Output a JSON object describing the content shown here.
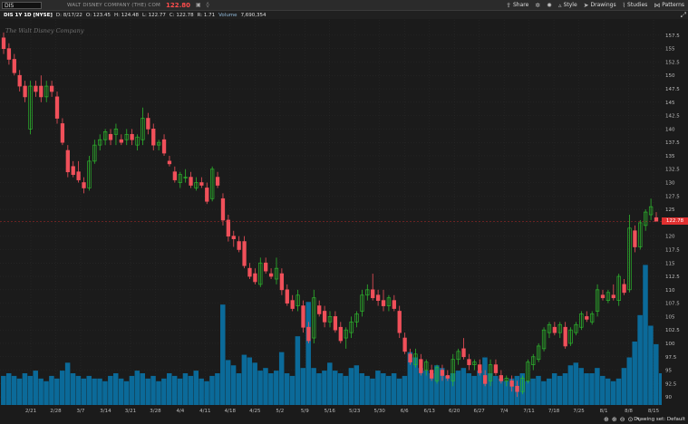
{
  "header": {
    "symbol": "DIS",
    "company": "WALT DISNEY COMPANY (THE) COM",
    "last_price": "122.80",
    "toolbar": {
      "share": "Share",
      "style": "Style",
      "drawings": "Drawings",
      "studies": "Studies",
      "patterns": "Patterns"
    }
  },
  "infobar": {
    "descriptor": "DIS 1Y 1D [NYSE]",
    "date": "D: 8/17/22",
    "open": "O: 123.45",
    "high": "H: 124.48",
    "low": "L: 122.77",
    "close": "C: 122.78",
    "range": "R: 1.71",
    "volume_label": "Volume",
    "volume": "7,690,354"
  },
  "watermark": "The Walt Disney Company",
  "price_tag": "122.78",
  "footer": {
    "drawing_set": "Drawing set: Default"
  },
  "chart_data": {
    "type": "candlestick",
    "y_ticks": [
      "157.5",
      "155",
      "152.5",
      "150",
      "147.5",
      "145",
      "142.5",
      "140",
      "137.5",
      "135",
      "132.5",
      "130",
      "127.5",
      "125",
      "122.5",
      "120",
      "117.5",
      "115",
      "112.5",
      "110",
      "107.5",
      "105",
      "102.5",
      "100",
      "97.5",
      "95",
      "92.5",
      "90"
    ],
    "ylim": [
      88.5,
      159
    ],
    "x_ticks": [
      "2/21",
      "2/28",
      "3/7",
      "3/14",
      "3/21",
      "3/28",
      "4/4",
      "4/11",
      "4/18",
      "4/25",
      "5/2",
      "5/9",
      "5/16",
      "5/23",
      "5/30",
      "6/6",
      "6/13",
      "6/20",
      "6/27",
      "7/4",
      "7/11",
      "7/18",
      "7/25",
      "8/1",
      "8/8",
      "8/15"
    ],
    "colors": {
      "up": "#2db52d",
      "down": "#f0505a",
      "volume": "#0b6a99",
      "background": "#1b1b1b",
      "grid": "#2c2c2c"
    },
    "candles": [
      {
        "o": 157,
        "h": 158,
        "l": 154,
        "c": 155
      },
      {
        "o": 155,
        "h": 156,
        "l": 152,
        "c": 153
      },
      {
        "o": 153,
        "h": 154,
        "l": 150,
        "c": 150.5
      },
      {
        "o": 150,
        "h": 151,
        "l": 147,
        "c": 148
      },
      {
        "o": 148,
        "h": 149,
        "l": 145,
        "c": 146
      },
      {
        "o": 140,
        "h": 149,
        "l": 139,
        "c": 148
      },
      {
        "o": 148,
        "h": 149,
        "l": 146,
        "c": 147
      },
      {
        "o": 148,
        "h": 150,
        "l": 145,
        "c": 146
      },
      {
        "o": 146,
        "h": 149,
        "l": 145,
        "c": 148
      },
      {
        "o": 148,
        "h": 149,
        "l": 146,
        "c": 147
      },
      {
        "o": 146,
        "h": 147,
        "l": 141,
        "c": 142
      },
      {
        "o": 141,
        "h": 142,
        "l": 137,
        "c": 137.5
      },
      {
        "o": 136,
        "h": 137,
        "l": 131,
        "c": 132
      },
      {
        "o": 133,
        "h": 134,
        "l": 131,
        "c": 131.5
      },
      {
        "o": 132,
        "h": 134,
        "l": 130,
        "c": 130.5
      },
      {
        "o": 130,
        "h": 131,
        "l": 128,
        "c": 129
      },
      {
        "o": 129,
        "h": 135,
        "l": 128.5,
        "c": 134
      },
      {
        "o": 134,
        "h": 138,
        "l": 133.5,
        "c": 137
      },
      {
        "o": 137,
        "h": 139,
        "l": 136,
        "c": 138
      },
      {
        "o": 138,
        "h": 140,
        "l": 137,
        "c": 139.5
      },
      {
        "o": 139,
        "h": 140,
        "l": 137,
        "c": 138
      },
      {
        "o": 139,
        "h": 141,
        "l": 137,
        "c": 140
      },
      {
        "o": 138,
        "h": 139,
        "l": 137,
        "c": 137.5
      },
      {
        "o": 138,
        "h": 140,
        "l": 137,
        "c": 139
      },
      {
        "o": 139,
        "h": 140,
        "l": 137,
        "c": 138
      },
      {
        "o": 137,
        "h": 139,
        "l": 136,
        "c": 138.5
      },
      {
        "o": 138,
        "h": 144,
        "l": 137,
        "c": 142
      },
      {
        "o": 142,
        "h": 143,
        "l": 139,
        "c": 140
      },
      {
        "o": 140,
        "h": 141,
        "l": 136,
        "c": 137
      },
      {
        "o": 137,
        "h": 138,
        "l": 136,
        "c": 137.5
      },
      {
        "o": 138,
        "h": 139,
        "l": 135,
        "c": 135.5
      },
      {
        "o": 134,
        "h": 135,
        "l": 133,
        "c": 133.5
      },
      {
        "o": 132,
        "h": 133,
        "l": 130,
        "c": 130.5
      },
      {
        "o": 130,
        "h": 132,
        "l": 129,
        "c": 131.5
      },
      {
        "o": 131,
        "h": 132.5,
        "l": 130,
        "c": 131
      },
      {
        "o": 131,
        "h": 132,
        "l": 129,
        "c": 129.5
      },
      {
        "o": 129,
        "h": 131,
        "l": 128.5,
        "c": 130
      },
      {
        "o": 130,
        "h": 131,
        "l": 129,
        "c": 129.5
      },
      {
        "o": 129,
        "h": 130,
        "l": 126,
        "c": 126.5
      },
      {
        "o": 127,
        "h": 133,
        "l": 126.5,
        "c": 132.5
      },
      {
        "o": 131,
        "h": 132,
        "l": 129,
        "c": 129.5
      },
      {
        "o": 127,
        "h": 128,
        "l": 122,
        "c": 123
      },
      {
        "o": 123,
        "h": 124,
        "l": 119,
        "c": 120
      },
      {
        "o": 120,
        "h": 121,
        "l": 118,
        "c": 119.5
      },
      {
        "o": 119,
        "h": 120,
        "l": 117,
        "c": 117.5
      },
      {
        "o": 119,
        "h": 120,
        "l": 114,
        "c": 114.5
      },
      {
        "o": 114,
        "h": 115,
        "l": 112,
        "c": 112.5
      },
      {
        "o": 113,
        "h": 114,
        "l": 111,
        "c": 111.5
      },
      {
        "o": 111,
        "h": 116,
        "l": 110.5,
        "c": 115
      },
      {
        "o": 115,
        "h": 116,
        "l": 113,
        "c": 113.5
      },
      {
        "o": 113,
        "h": 114,
        "l": 112,
        "c": 112.5
      },
      {
        "o": 112,
        "h": 116,
        "l": 111,
        "c": 114
      },
      {
        "o": 113,
        "h": 114,
        "l": 109,
        "c": 110
      },
      {
        "o": 110,
        "h": 111,
        "l": 107,
        "c": 107.5
      },
      {
        "o": 108,
        "h": 109,
        "l": 106,
        "c": 106.5
      },
      {
        "o": 107,
        "h": 110,
        "l": 106,
        "c": 109
      },
      {
        "o": 107,
        "h": 108,
        "l": 102,
        "c": 103
      },
      {
        "o": 103,
        "h": 104,
        "l": 100,
        "c": 100.5
      },
      {
        "o": 101,
        "h": 110,
        "l": 100,
        "c": 108.5
      },
      {
        "o": 107,
        "h": 108,
        "l": 105,
        "c": 105.5
      },
      {
        "o": 106,
        "h": 107,
        "l": 103,
        "c": 104
      },
      {
        "o": 104,
        "h": 106,
        "l": 103,
        "c": 105
      },
      {
        "o": 105,
        "h": 106,
        "l": 102,
        "c": 102.5
      },
      {
        "o": 103,
        "h": 104,
        "l": 100,
        "c": 100.5
      },
      {
        "o": 101,
        "h": 103,
        "l": 99,
        "c": 102.5
      },
      {
        "o": 102,
        "h": 105,
        "l": 101,
        "c": 104
      },
      {
        "o": 104,
        "h": 106,
        "l": 103,
        "c": 105.5
      },
      {
        "o": 106,
        "h": 110,
        "l": 105,
        "c": 109
      },
      {
        "o": 109,
        "h": 111,
        "l": 108,
        "c": 110
      },
      {
        "o": 110,
        "h": 113,
        "l": 108,
        "c": 108.5
      },
      {
        "o": 109,
        "h": 110,
        "l": 107,
        "c": 108
      },
      {
        "o": 108,
        "h": 110,
        "l": 106,
        "c": 107
      },
      {
        "o": 107,
        "h": 109,
        "l": 106,
        "c": 108.5
      },
      {
        "o": 108,
        "h": 109,
        "l": 106,
        "c": 106.5
      },
      {
        "o": 106,
        "h": 107,
        "l": 101,
        "c": 102
      },
      {
        "o": 101,
        "h": 102,
        "l": 98,
        "c": 98.5
      },
      {
        "o": 98,
        "h": 99,
        "l": 96,
        "c": 96.5
      },
      {
        "o": 96,
        "h": 99,
        "l": 95.5,
        "c": 98
      },
      {
        "o": 97,
        "h": 98,
        "l": 94,
        "c": 94.5
      },
      {
        "o": 95,
        "h": 97,
        "l": 94,
        "c": 96.5
      },
      {
        "o": 95,
        "h": 96,
        "l": 93,
        "c": 93.5
      },
      {
        "o": 93,
        "h": 96,
        "l": 92.5,
        "c": 95.5
      },
      {
        "o": 95,
        "h": 96,
        "l": 93,
        "c": 94
      },
      {
        "o": 94,
        "h": 95,
        "l": 93,
        "c": 93.5
      },
      {
        "o": 93,
        "h": 98,
        "l": 92,
        "c": 97
      },
      {
        "o": 97,
        "h": 99,
        "l": 96,
        "c": 98.5
      },
      {
        "o": 99,
        "h": 101,
        "l": 97,
        "c": 97.5
      },
      {
        "o": 97,
        "h": 98,
        "l": 95,
        "c": 96
      },
      {
        "o": 96,
        "h": 97,
        "l": 95,
        "c": 96.5
      },
      {
        "o": 96,
        "h": 97,
        "l": 94,
        "c": 94.5
      },
      {
        "o": 94,
        "h": 95,
        "l": 92,
        "c": 92.5
      },
      {
        "o": 93,
        "h": 97,
        "l": 92,
        "c": 96
      },
      {
        "o": 96,
        "h": 97,
        "l": 94,
        "c": 94.5
      },
      {
        "o": 94,
        "h": 95,
        "l": 92.5,
        "c": 93
      },
      {
        "o": 93,
        "h": 94,
        "l": 92,
        "c": 93.5
      },
      {
        "o": 93,
        "h": 94,
        "l": 91,
        "c": 92
      },
      {
        "o": 92,
        "h": 93,
        "l": 90,
        "c": 91
      },
      {
        "o": 91,
        "h": 94,
        "l": 90.5,
        "c": 93.5
      },
      {
        "o": 93,
        "h": 97,
        "l": 92.5,
        "c": 96.5
      },
      {
        "o": 96,
        "h": 98,
        "l": 95,
        "c": 97.5
      },
      {
        "o": 97,
        "h": 100,
        "l": 96.5,
        "c": 99.5
      },
      {
        "o": 99,
        "h": 103,
        "l": 98.5,
        "c": 102.5
      },
      {
        "o": 102,
        "h": 104,
        "l": 101,
        "c": 103.5
      },
      {
        "o": 103,
        "h": 104,
        "l": 101.5,
        "c": 102
      },
      {
        "o": 102,
        "h": 104,
        "l": 101,
        "c": 103.5
      },
      {
        "o": 103,
        "h": 104,
        "l": 99,
        "c": 99.5
      },
      {
        "o": 100,
        "h": 103,
        "l": 99.5,
        "c": 102.5
      },
      {
        "o": 102,
        "h": 104,
        "l": 101.5,
        "c": 103.5
      },
      {
        "o": 103,
        "h": 106,
        "l": 102.5,
        "c": 105.5
      },
      {
        "o": 105,
        "h": 106,
        "l": 104,
        "c": 104.5
      },
      {
        "o": 104,
        "h": 106,
        "l": 103.5,
        "c": 105.5
      },
      {
        "o": 106,
        "h": 111,
        "l": 105,
        "c": 110
      },
      {
        "o": 109,
        "h": 110,
        "l": 108,
        "c": 108.5
      },
      {
        "o": 108,
        "h": 110,
        "l": 107.5,
        "c": 109.5
      },
      {
        "o": 109,
        "h": 111,
        "l": 108,
        "c": 108.5
      },
      {
        "o": 108,
        "h": 113,
        "l": 107,
        "c": 112.5
      },
      {
        "o": 111,
        "h": 112,
        "l": 109,
        "c": 109.5
      },
      {
        "o": 110,
        "h": 124,
        "l": 109.5,
        "c": 121.5
      },
      {
        "o": 121,
        "h": 122,
        "l": 117,
        "c": 118
      },
      {
        "o": 118,
        "h": 123,
        "l": 117.5,
        "c": 122.5
      },
      {
        "o": 122,
        "h": 125,
        "l": 121,
        "c": 124.5
      },
      {
        "o": 124,
        "h": 127,
        "l": 123,
        "c": 125.5
      },
      {
        "o": 123.45,
        "h": 124.48,
        "l": 122.77,
        "c": 122.78
      }
    ],
    "volume": [
      11,
      12,
      11,
      10,
      12,
      11,
      13,
      10,
      9,
      11,
      10,
      13,
      16,
      12,
      11,
      10,
      11,
      10,
      10,
      9,
      11,
      12,
      10,
      9,
      11,
      13,
      12,
      10,
      11,
      9,
      10,
      12,
      11,
      10,
      12,
      11,
      13,
      10,
      9,
      11,
      12,
      38,
      17,
      15,
      12,
      19,
      18,
      16,
      13,
      14,
      12,
      13,
      20,
      12,
      11,
      26,
      14,
      39,
      14,
      12,
      13,
      16,
      13,
      12,
      11,
      14,
      15,
      12,
      11,
      10,
      13,
      12,
      11,
      12,
      10,
      11,
      20,
      18,
      14,
      13,
      12,
      15,
      14,
      11,
      12,
      13,
      14,
      12,
      11,
      13,
      18,
      12,
      11,
      10,
      9,
      10,
      11,
      12,
      9,
      10,
      11,
      9,
      10,
      12,
      11,
      12,
      15,
      16,
      14,
      12,
      12,
      14,
      11,
      10,
      9,
      10,
      14,
      18,
      24,
      34,
      53,
      30,
      23,
      12
    ]
  }
}
